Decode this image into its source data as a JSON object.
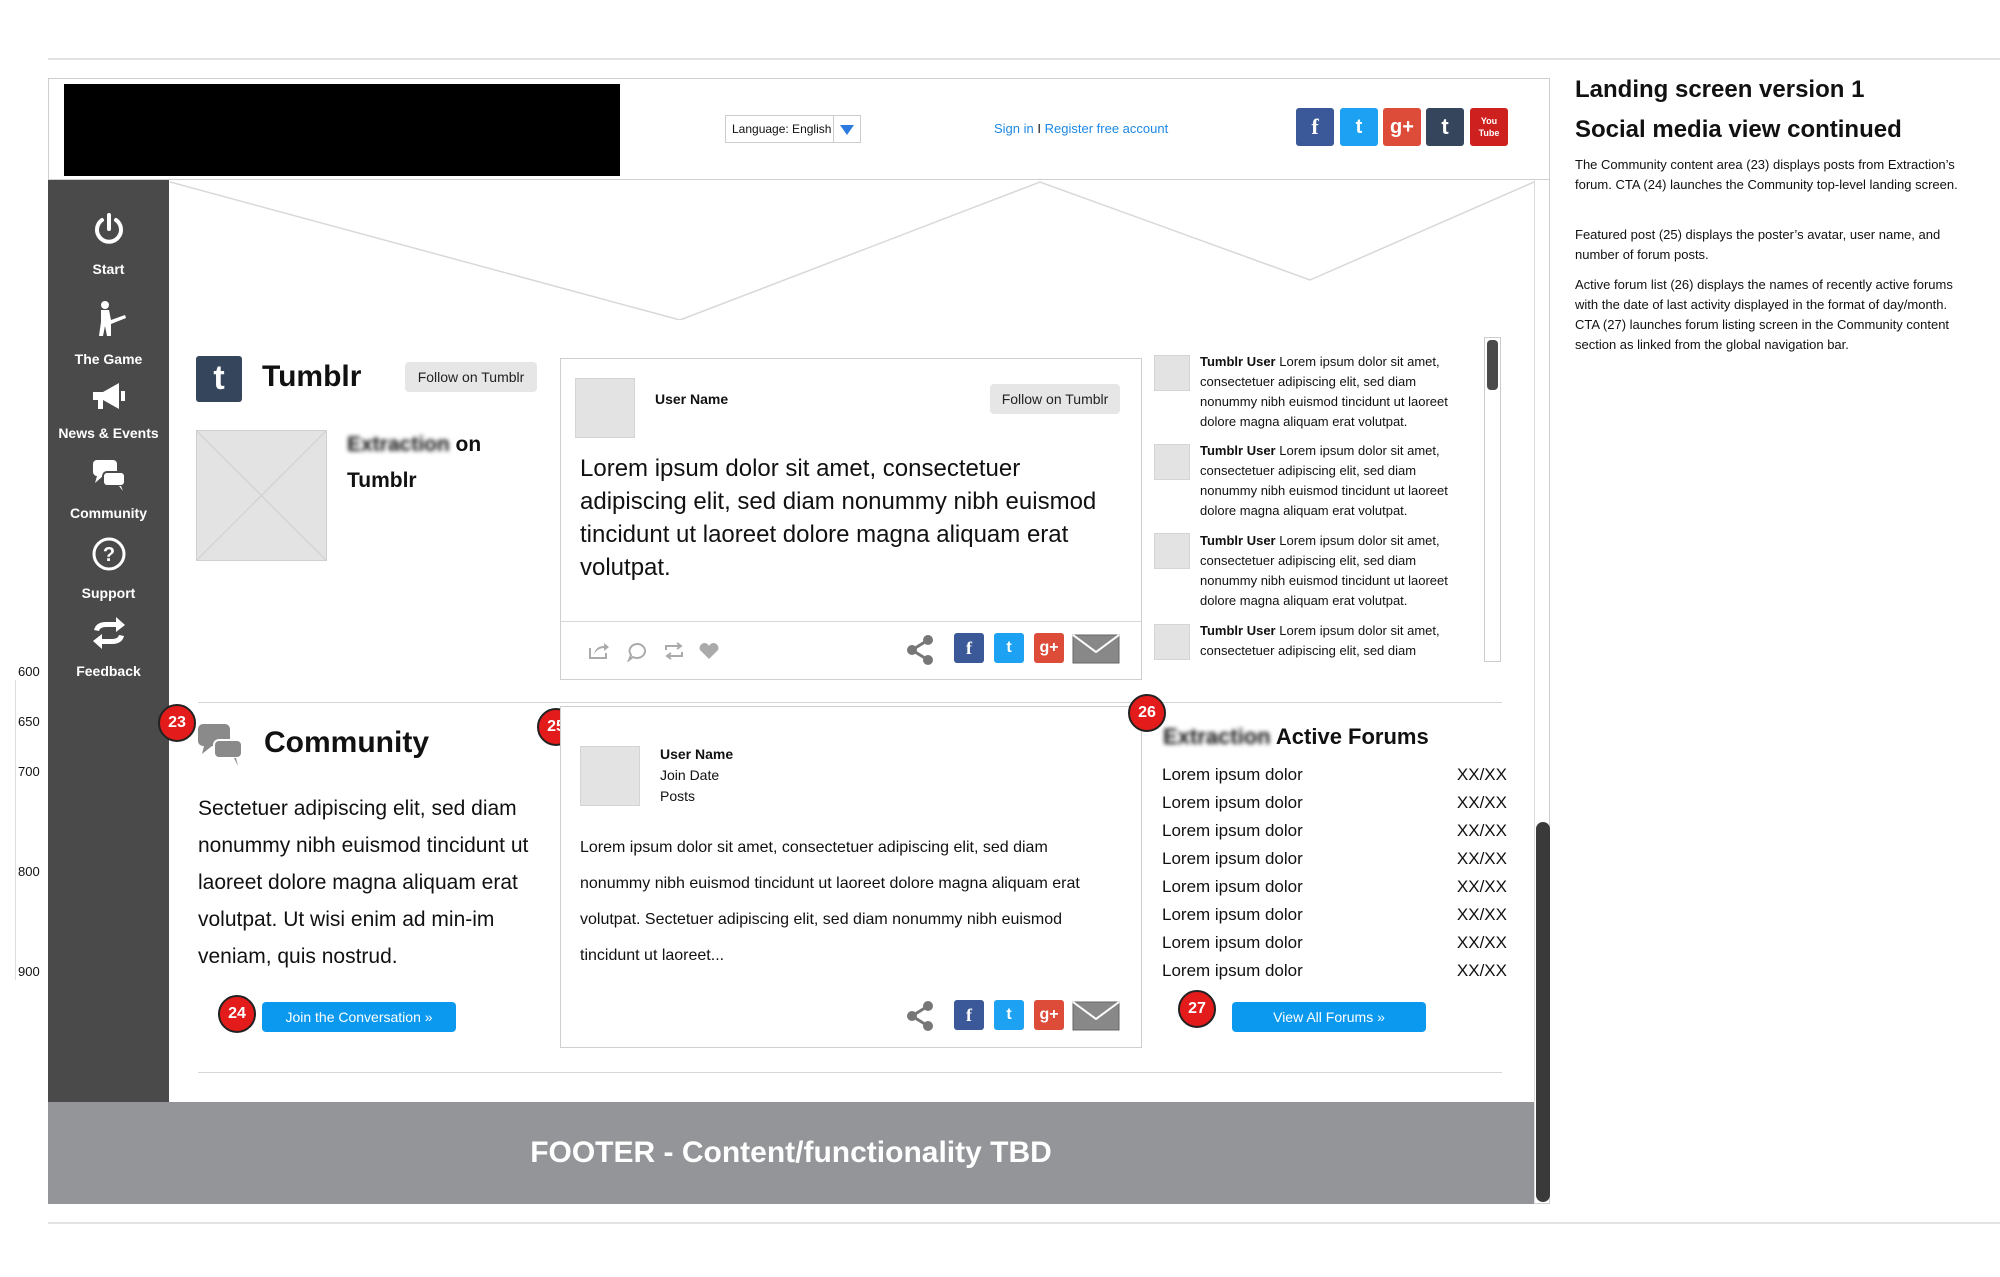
{
  "header": {
    "language_label": "Language: English",
    "sign_in": "Sign in",
    "separator": "I",
    "register": "Register free account",
    "social": [
      {
        "name": "facebook-icon",
        "glyph": "f",
        "color": "#3b5998"
      },
      {
        "name": "twitter-icon",
        "glyph": "t",
        "color": "#1da1f2"
      },
      {
        "name": "google-plus-icon",
        "glyph": "g+",
        "color": "#dd4b39"
      },
      {
        "name": "tumblr-icon",
        "glyph": "t",
        "color": "#35465c"
      },
      {
        "name": "youtube-icon",
        "glyph": "You Tube",
        "color": "#cd201f"
      }
    ]
  },
  "sidebar": {
    "items": [
      {
        "label": "Start",
        "icon": "power-icon"
      },
      {
        "label": "The Game",
        "icon": "soldier-icon"
      },
      {
        "label": "News & Events",
        "icon": "megaphone-icon"
      },
      {
        "label": "Community",
        "icon": "chat-icon"
      },
      {
        "label": "Support",
        "icon": "question-icon"
      },
      {
        "label": "Feedback",
        "icon": "feedback-arrows-icon"
      }
    ]
  },
  "ruler": {
    "ticks": [
      "600",
      "650",
      "700",
      "800",
      "900"
    ]
  },
  "tumblr": {
    "title": "Tumblr",
    "follow_label": "Follow on Tumblr",
    "brand_blurred": "Extraction",
    "brand_suffix": "on",
    "brand_line2": "Tumblr",
    "post": {
      "user_name": "User Name",
      "follow_label": "Follow on Tumblr",
      "body": "Lorem ipsum dolor sit amet, consectetuer adipiscing elit, sed diam nonummy nibh euismod tincidunt ut laoreet dolore magna aliquam erat volutpat."
    },
    "feed": [
      {
        "user": "Tumblr User",
        "text": "Lorem ipsum dolor sit amet, consectetuer adipiscing elit, sed diam nonummy nibh euismod tincidunt ut laoreet dolore magna aliquam erat volutpat."
      },
      {
        "user": "Tumblr User",
        "text": "Lorem ipsum dolor sit amet, consectetuer adipiscing elit, sed diam nonummy nibh euismod tincidunt ut laoreet dolore magna aliquam erat volutpat."
      },
      {
        "user": "Tumblr User",
        "text": "Lorem ipsum dolor sit amet, consectetuer adipiscing elit, sed diam nonummy nibh euismod tincidunt ut laoreet dolore magna aliquam erat volutpat."
      },
      {
        "user": "Tumblr User",
        "text": "Lorem ipsum dolor sit amet, consectetuer adipiscing elit, sed diam"
      }
    ]
  },
  "community": {
    "badge_23": "23",
    "title": "Community",
    "body": "Sectetuer adipiscing elit, sed diam nonummy nibh euismod tincidunt ut laoreet dolore magna aliquam erat volutpat. Ut wisi enim ad min-im veniam, quis nostrud.",
    "badge_24": "24",
    "cta": "Join the Conversation »",
    "badge_25": "25",
    "featured": {
      "user_name": "User Name",
      "join_date": "Join Date",
      "posts": "Posts",
      "body": "Lorem ipsum dolor sit amet, consectetuer adipiscing elit, sed diam nonummy nibh euismod tincidunt ut laoreet dolore magna aliquam erat volutpat. Sectetuer adipiscing elit, sed diam nonummy nibh euismod tincidunt ut laoreet..."
    },
    "badge_26": "26",
    "forums_blurred": "Extraction",
    "forums_title": "Active Forums",
    "forums": [
      {
        "name": "Lorem ipsum dolor",
        "date": "XX/XX"
      },
      {
        "name": "Lorem ipsum dolor",
        "date": "XX/XX"
      },
      {
        "name": "Lorem ipsum dolor",
        "date": "XX/XX"
      },
      {
        "name": "Lorem ipsum dolor",
        "date": "XX/XX"
      },
      {
        "name": "Lorem ipsum dolor",
        "date": "XX/XX"
      },
      {
        "name": "Lorem ipsum dolor",
        "date": "XX/XX"
      },
      {
        "name": "Lorem ipsum dolor",
        "date": "XX/XX"
      },
      {
        "name": "Lorem ipsum dolor",
        "date": "XX/XX"
      }
    ],
    "badge_27": "27",
    "forums_cta": "View All Forums »"
  },
  "footer": {
    "text": "FOOTER - Content/functionality TBD"
  },
  "notes": {
    "title1": "Landing screen version 1",
    "title2": "Social media view continued",
    "p1": "The Community content area (23) displays posts from Extraction’s forum. CTA (24) launches the Community top-level landing screen.",
    "p2": "Featured post (25) displays the poster’s avatar, user name, and number of forum posts.",
    "p3": "Active forum list (26) displays the names of recently active forums with the date of last activity displayed in the format of day/month. CTA (27) launches forum listing screen in the Community content section as linked from the global navigation bar."
  }
}
